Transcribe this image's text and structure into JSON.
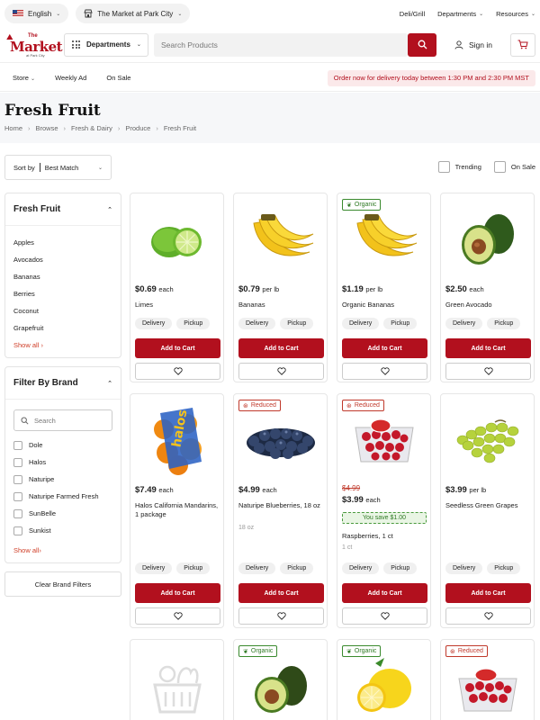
{
  "top": {
    "language": "English",
    "store": "The Market at Park City",
    "links": [
      "Deli/Grill",
      "Departments",
      "Resources"
    ]
  },
  "header": {
    "logo_word": "Market",
    "logo_prefix": "The",
    "logo_sub": "at Park City",
    "departments_label": "Departments",
    "search_placeholder": "Search Products",
    "signin_label": "Sign in"
  },
  "subnav": {
    "items": [
      "Store",
      "Weekly Ad",
      "On Sale"
    ],
    "banner": "Order now for delivery today between 1:30 PM and 2:30 PM MST"
  },
  "page": {
    "title": "Fresh Fruit",
    "breadcrumbs": [
      "Home",
      "Browse",
      "Fresh & Dairy",
      "Produce",
      "Fresh Fruit"
    ]
  },
  "sort": {
    "label": "Sort by",
    "value": "Best Match",
    "toggles": [
      "Trending",
      "On Sale"
    ]
  },
  "sidebar": {
    "category_title": "Fresh Fruit",
    "categories": [
      "Apples",
      "Avocados",
      "Bananas",
      "Berries",
      "Coconut",
      "Grapefruit"
    ],
    "show_all": "Show all",
    "brand_title": "Filter By Brand",
    "brand_search_placeholder": "Search",
    "brands": [
      "Dole",
      "Halos",
      "Naturipe",
      "Naturipe Farmed Fresh",
      "SunBelle",
      "Sunkist"
    ],
    "brand_show_all": "Show all",
    "clear_label": "Clear Brand Filters"
  },
  "labels": {
    "add_to_cart": "Add to Cart",
    "delivery": "Delivery",
    "pickup": "Pickup"
  },
  "products": [
    {
      "name": "Limes",
      "price": "$0.69",
      "unit": "each",
      "tag": "",
      "icon": "limes"
    },
    {
      "name": "Bananas",
      "price": "$0.79",
      "unit": "per lb",
      "tag": "",
      "icon": "bananas"
    },
    {
      "name": "Organic Bananas",
      "price": "$1.19",
      "unit": "per lb",
      "tag": "Organic",
      "icon": "bananas"
    },
    {
      "name": "Green Avocado",
      "price": "$2.50",
      "unit": "each",
      "tag": "",
      "icon": "avocado"
    },
    {
      "name": "Halos California Mandarins, 1 package",
      "price": "$7.49",
      "unit": "each",
      "tag": "",
      "icon": "halos-bag"
    },
    {
      "name": "Naturipe Blueberries, 18 oz",
      "price": "$4.99",
      "unit": "each",
      "size": "18 oz",
      "tag": "Reduced",
      "icon": "blueberries"
    },
    {
      "name": "Raspberries, 1 ct",
      "price": "$3.99",
      "unit": "each",
      "old_price": "$4.99",
      "savings": "You save $1.00",
      "size": "1 ct",
      "tag": "Reduced",
      "icon": "raspberries"
    },
    {
      "name": "Seedless Green Grapes",
      "price": "$3.99",
      "unit": "per lb",
      "tag": "",
      "icon": "grapes"
    },
    {
      "name": "",
      "price": "",
      "unit": "",
      "tag": "",
      "icon": "placeholder-basket"
    },
    {
      "name": "",
      "price": "",
      "unit": "",
      "tag": "Organic",
      "icon": "avocado"
    },
    {
      "name": "",
      "price": "",
      "unit": "",
      "tag": "Organic",
      "icon": "lemon"
    },
    {
      "name": "",
      "price": "",
      "unit": "",
      "tag": "Reduced",
      "icon": "raspberries"
    }
  ],
  "colors": {
    "brand_red": "#b2101e",
    "organic_green": "#2f7a24",
    "reduced_red": "#c0392b",
    "banner_bg": "#fbe9ea"
  }
}
